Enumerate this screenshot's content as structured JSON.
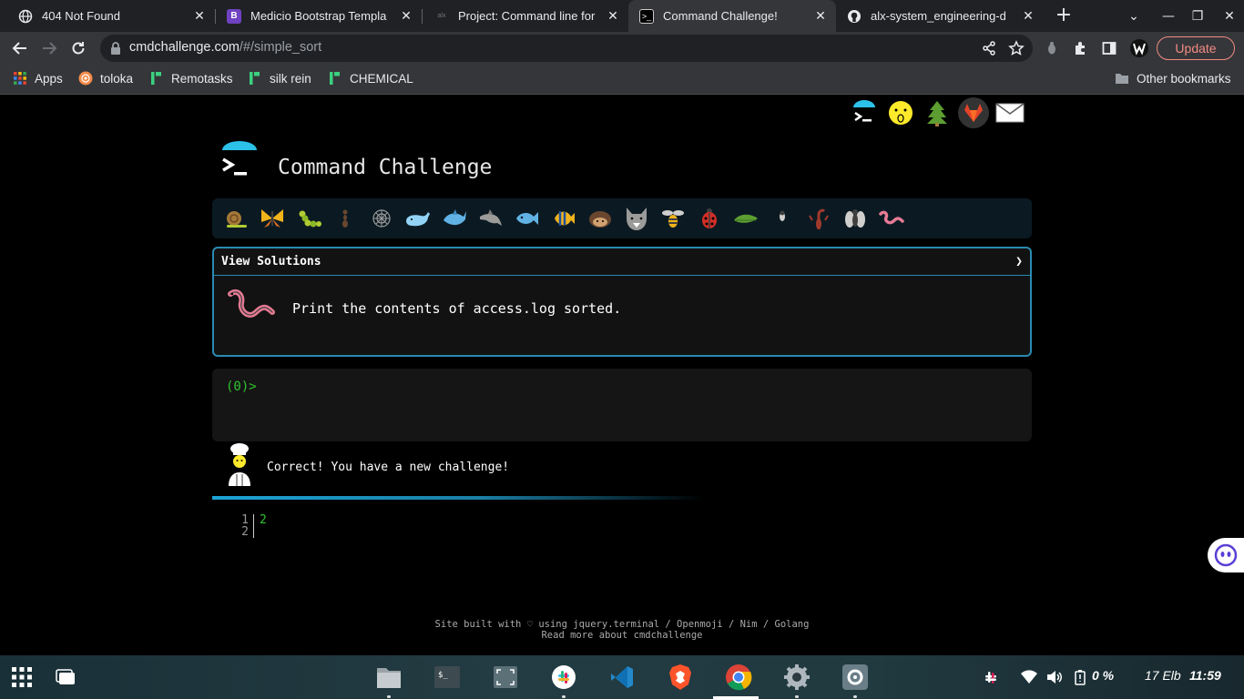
{
  "browser": {
    "tabs": [
      {
        "title": "404 Not Found",
        "favicon": "globe-icon"
      },
      {
        "title": "Medicio Bootstrap Templa",
        "favicon": "bootstrap-b-icon"
      },
      {
        "title": "Project: Command line for",
        "favicon": "alx-icon"
      },
      {
        "title": "Command Challenge!",
        "favicon": "terminal-icon",
        "active": true
      },
      {
        "title": "alx-system_engineering-d",
        "favicon": "github-icon"
      }
    ],
    "url_host": "cmdchallenge.com",
    "url_path": "/#/simple_sort",
    "update_label": "Update",
    "bookmarks": [
      {
        "label": "Apps",
        "icon": "apps-grid-icon"
      },
      {
        "label": "toloka",
        "icon": "toloka-icon"
      },
      {
        "label": "Remotasks",
        "icon": "remotasks-icon"
      },
      {
        "label": "silk rein",
        "icon": "remotasks-icon"
      },
      {
        "label": "CHEMICAL",
        "icon": "remotasks-icon"
      }
    ],
    "other_bookmarks": "Other bookmarks"
  },
  "page": {
    "title": "Command Challenge",
    "view_solutions": "View Solutions",
    "chevron": "❯",
    "task": "Print the contents of access.log sorted.",
    "prompt": "(0)>",
    "result_message": "Correct! You have a new challenge!",
    "output_lines": [
      {
        "num": "1",
        "text": "2"
      },
      {
        "num": "2",
        "text": ""
      }
    ],
    "footer_line1": "Site built with ♡ using jquery.terminal / Openmoji / Nim / Golang",
    "footer_line2": "Read more about cmdchallenge"
  },
  "taskbar": {
    "battery": "0 %",
    "date": "17 Elb",
    "time": "11:59"
  },
  "colors": {
    "accent": "#2a8ab0",
    "terminal_green": "#2fc52f",
    "update_red": "#f28b82"
  }
}
